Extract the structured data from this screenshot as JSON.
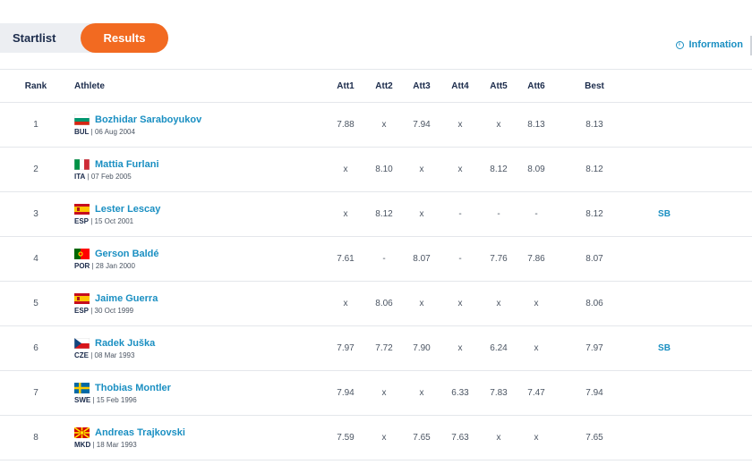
{
  "tabs": [
    {
      "label": "Startlist",
      "active": false
    },
    {
      "label": "Results",
      "active": true
    }
  ],
  "info_link": {
    "label": "Information",
    "icon": "info-icon"
  },
  "accent_color": "#f26a21",
  "link_color": "#1a8fc2",
  "columns": {
    "rank": "Rank",
    "athlete": "Athlete",
    "att1": "Att1",
    "att2": "Att2",
    "att3": "Att3",
    "att4": "Att4",
    "att5": "Att5",
    "att6": "Att6",
    "best": "Best"
  },
  "rows": [
    {
      "rank": "1",
      "name": "Bozhidar Saraboyukov",
      "country": "BUL",
      "dob": "06 Aug 2004",
      "flag": "bulgaria-flag",
      "att": [
        "7.88",
        "x",
        "7.94",
        "x",
        "x",
        "8.13"
      ],
      "best": "8.13",
      "note": ""
    },
    {
      "rank": "2",
      "name": "Mattia Furlani",
      "country": "ITA",
      "dob": "07 Feb 2005",
      "flag": "italy-flag",
      "att": [
        "x",
        "8.10",
        "x",
        "x",
        "8.12",
        "8.09"
      ],
      "best": "8.12",
      "note": ""
    },
    {
      "rank": "3",
      "name": "Lester Lescay",
      "country": "ESP",
      "dob": "15 Oct 2001",
      "flag": "spain-flag",
      "att": [
        "x",
        "8.12",
        "x",
        "-",
        "-",
        "-"
      ],
      "best": "8.12",
      "note": "SB"
    },
    {
      "rank": "4",
      "name": "Gerson Baldé",
      "country": "POR",
      "dob": "28 Jan 2000",
      "flag": "portugal-flag",
      "att": [
        "7.61",
        "-",
        "8.07",
        "-",
        "7.76",
        "7.86"
      ],
      "best": "8.07",
      "note": ""
    },
    {
      "rank": "5",
      "name": "Jaime Guerra",
      "country": "ESP",
      "dob": "30 Oct 1999",
      "flag": "spain-flag",
      "att": [
        "x",
        "8.06",
        "x",
        "x",
        "x",
        "x"
      ],
      "best": "8.06",
      "note": ""
    },
    {
      "rank": "6",
      "name": "Radek Juška",
      "country": "CZE",
      "dob": "08 Mar 1993",
      "flag": "czech-flag",
      "att": [
        "7.97",
        "7.72",
        "7.90",
        "x",
        "6.24",
        "x"
      ],
      "best": "7.97",
      "note": "SB"
    },
    {
      "rank": "7",
      "name": "Thobias Montler",
      "country": "SWE",
      "dob": "15 Feb 1996",
      "flag": "sweden-flag",
      "att": [
        "7.94",
        "x",
        "x",
        "6.33",
        "7.83",
        "7.47"
      ],
      "best": "7.94",
      "note": ""
    },
    {
      "rank": "8",
      "name": "Andreas Trajkovski",
      "country": "MKD",
      "dob": "18 Mar 1993",
      "flag": "macedonia-flag",
      "att": [
        "7.59",
        "x",
        "7.65",
        "7.63",
        "x",
        "x"
      ],
      "best": "7.65",
      "note": ""
    }
  ]
}
